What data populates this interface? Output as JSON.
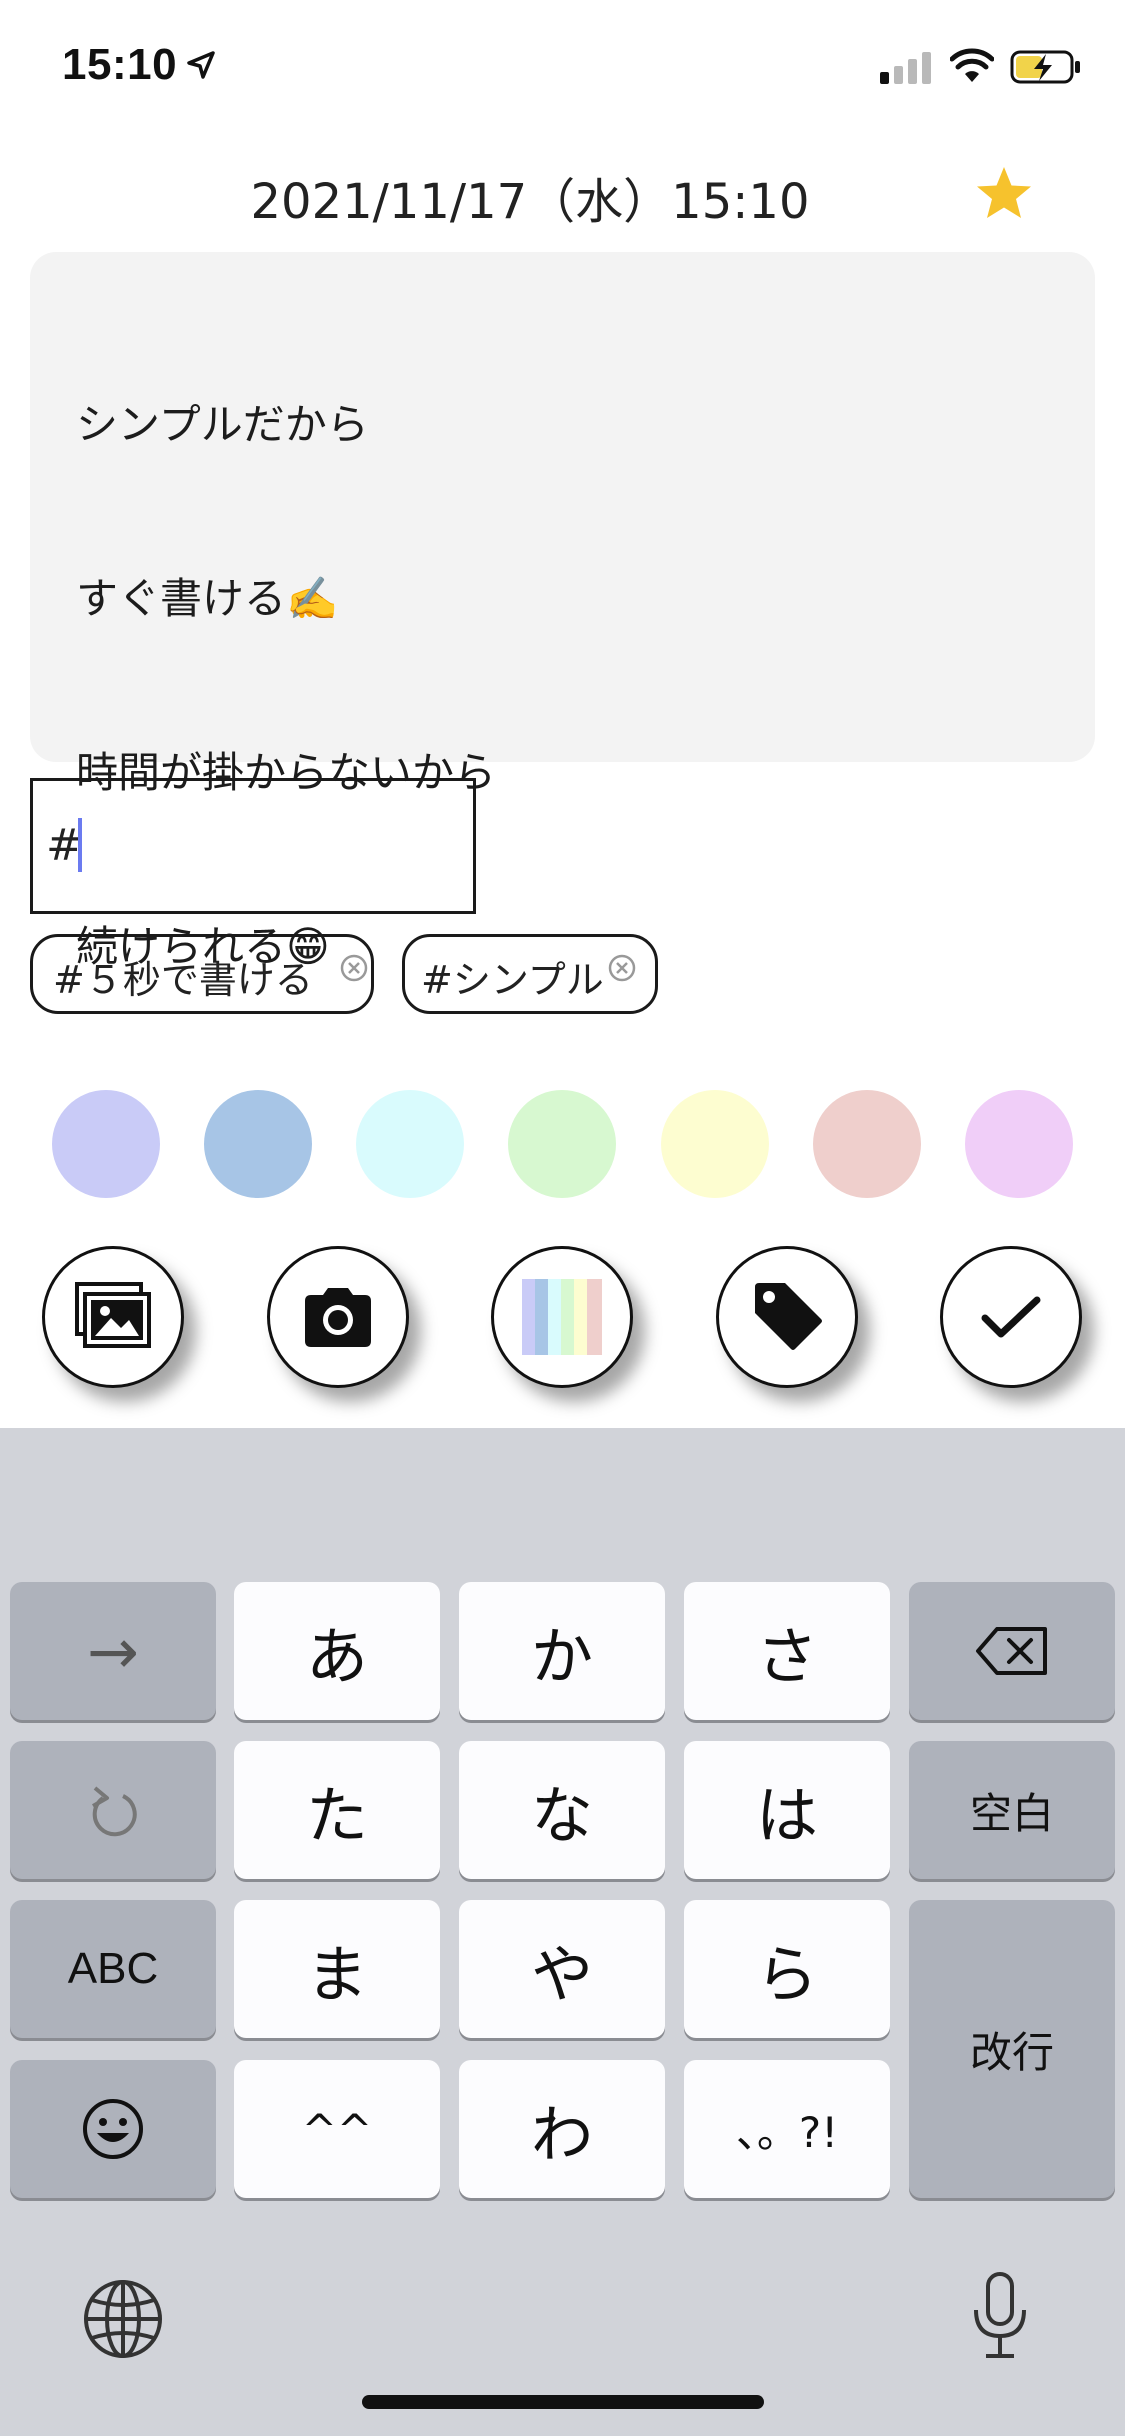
{
  "status_bar": {
    "time": "15:10"
  },
  "header": {
    "date": "2021/11/17（水）15:10"
  },
  "memo": {
    "lines": [
      "シンプルだから",
      "すぐ書ける✍️",
      "時間が掛からないから",
      "続けられる😁"
    ]
  },
  "tag_input": {
    "value": "#"
  },
  "tags": [
    {
      "label": "#５秒で書ける"
    },
    {
      "label": "#シンプル"
    }
  ],
  "colors": [
    "#c9cbf7",
    "#a7c5e6",
    "#d9fbfd",
    "#d7f8d0",
    "#fdfdd0",
    "#efcfcc",
    "#f0cef8"
  ],
  "actions": [
    "gallery-icon",
    "camera-icon",
    "palette-icon",
    "tag-icon",
    "check-icon"
  ],
  "keyboard": {
    "row1": [
      "→",
      "あ",
      "か",
      "さ",
      "⌫"
    ],
    "row2": [
      "↺",
      "た",
      "な",
      "は",
      "空白"
    ],
    "row3": [
      "ABC",
      "ま",
      "や",
      "ら"
    ],
    "row4": [
      "☺",
      "^^",
      "わ",
      "、。?!"
    ],
    "enter": "改行"
  }
}
